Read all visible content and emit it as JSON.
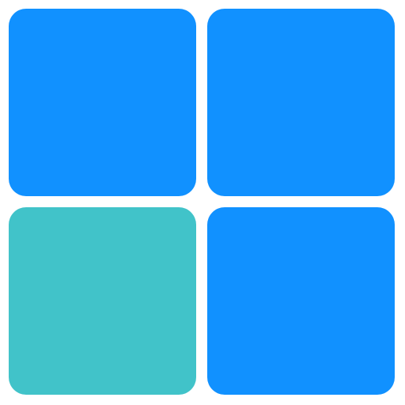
{
  "icon": {
    "name": "four-square-grid-icon",
    "tiles": [
      {
        "id": "top-left",
        "color": "#1191FF"
      },
      {
        "id": "top-right",
        "color": "#1191FF"
      },
      {
        "id": "bottom-left",
        "color": "#41C3C9"
      },
      {
        "id": "bottom-right",
        "color": "#1191FF"
      }
    ]
  }
}
